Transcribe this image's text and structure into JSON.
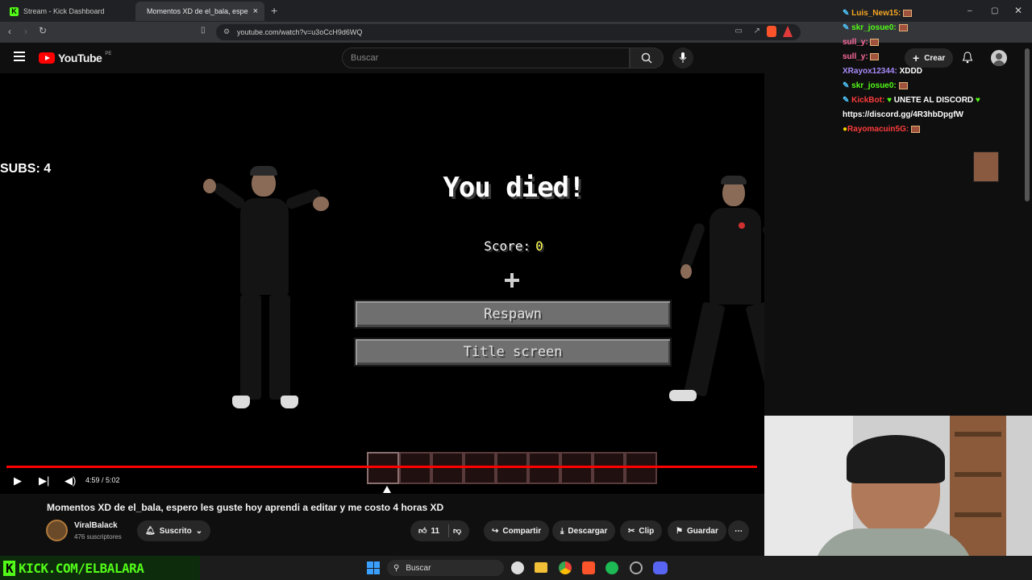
{
  "browser": {
    "tabs": [
      {
        "label": "Stream - Kick Dashboard",
        "active": false
      },
      {
        "label": "Momentos XD de el_bala, espe",
        "active": true
      }
    ],
    "url": "youtube.com/watch?v=u3oCcH9d6WQ"
  },
  "youtube": {
    "logo_text": "YouTube",
    "country": "PE",
    "search_placeholder": "Buscar",
    "create_label": "Crear"
  },
  "video": {
    "subs_overlay": "SUBS: 4",
    "death_title": "You died!",
    "score_label": "Score:",
    "score_value": "0",
    "respawn_label": "Respawn",
    "title_screen_label": "Title screen",
    "time": "4:59 / 5:02",
    "progress": 0.99
  },
  "meta": {
    "title": "Momentos XD de el_bala, espero les guste hoy aprendi a editar y me costo 4 horas XD",
    "channel_name": "ViralBalack",
    "subscribers": "476 suscriptores",
    "subscribed_label": "Suscrito",
    "likes": "11",
    "share": "Compartir",
    "download": "Descargar",
    "clip": "Clip",
    "save": "Guardar"
  },
  "chat": {
    "messages": [
      {
        "user": "Luis_New15:",
        "text": "",
        "color": "#f5a623"
      },
      {
        "user": "skr_josue0:",
        "text": "",
        "color": "#53fc18"
      },
      {
        "user": "sull_y:",
        "text": "",
        "color": "#ff6b9d"
      },
      {
        "user": "sull_y:",
        "text": "",
        "color": "#ff6b9d"
      },
      {
        "user": "XRayox12344:",
        "text": "XDDD",
        "color": "#a78bfa"
      },
      {
        "user": "skr_josue0:",
        "text": "",
        "color": "#53fc18"
      },
      {
        "user": "KickBot:",
        "text": "UNETE AL DISCORD",
        "color": "#ff3b3b"
      },
      {
        "user": "",
        "text": "https://discord.gg/4R3hbDpgfW",
        "color": "#ffffff"
      },
      {
        "user": "Rayomacuin5G:",
        "text": "",
        "color": "#ff3b3b"
      }
    ]
  },
  "overlay": {
    "kick_url": "KICK.COM/ELBALARA"
  },
  "taskbar": {
    "search_label": "Buscar"
  }
}
